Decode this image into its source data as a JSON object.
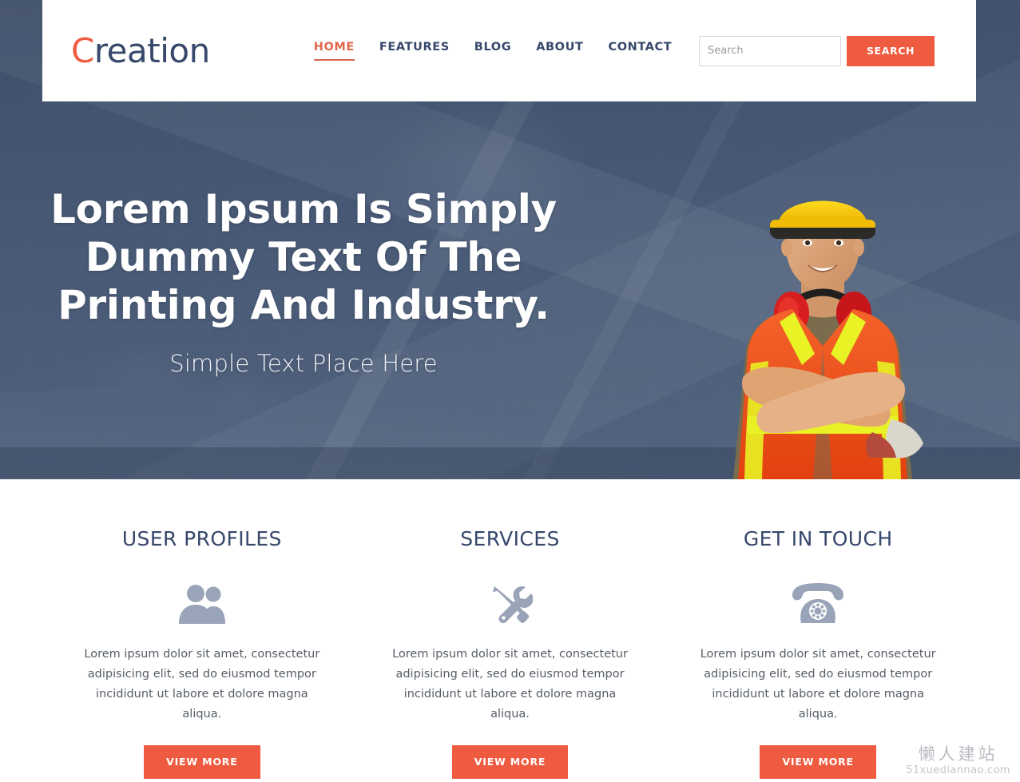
{
  "site": {
    "logo_prefix": "C",
    "logo_rest": "reation",
    "accent_color": "#ef5b40",
    "navy_color": "#37486b"
  },
  "header": {
    "nav": [
      {
        "label": "HOME",
        "active": true
      },
      {
        "label": "FEATURES",
        "active": false
      },
      {
        "label": "BLOG",
        "active": false
      },
      {
        "label": "ABOUT",
        "active": false
      },
      {
        "label": "CONTACT",
        "active": false
      }
    ],
    "search": {
      "placeholder": "Search",
      "value": "",
      "button_label": "SEARCH"
    }
  },
  "hero": {
    "title_line1": "Lorem Ipsum Is Simply",
    "title_line2": "Dummy Text Of The",
    "title_line3": "Printing And Industry.",
    "subtitle": "Simple Text Place Here",
    "background_image": "construction-blueprint-desk-photo",
    "figure_image": "construction-worker-photo"
  },
  "features": [
    {
      "title": "USER PROFILES",
      "icon": "users-icon",
      "text": "Lorem ipsum dolor sit amet, consectetur adipisicing elit, sed do eiusmod tempor incididunt ut labore et dolore magna aliqua.",
      "button_label": "VIEW MORE"
    },
    {
      "title": "SERVICES",
      "icon": "tools-icon",
      "text": "Lorem ipsum dolor sit amet, consectetur adipisicing elit, sed do eiusmod tempor incididunt ut labore et dolore magna aliqua.",
      "button_label": "VIEW MORE"
    },
    {
      "title": "GET IN TOUCH",
      "icon": "telephone-icon",
      "text": "Lorem ipsum dolor sit amet, consectetur adipisicing elit, sed do eiusmod tempor incididunt ut labore et dolore magna aliqua.",
      "button_label": "VIEW MORE"
    }
  ],
  "watermark": {
    "chinese": "懒人建站",
    "domain": "51xuediannao.com"
  }
}
